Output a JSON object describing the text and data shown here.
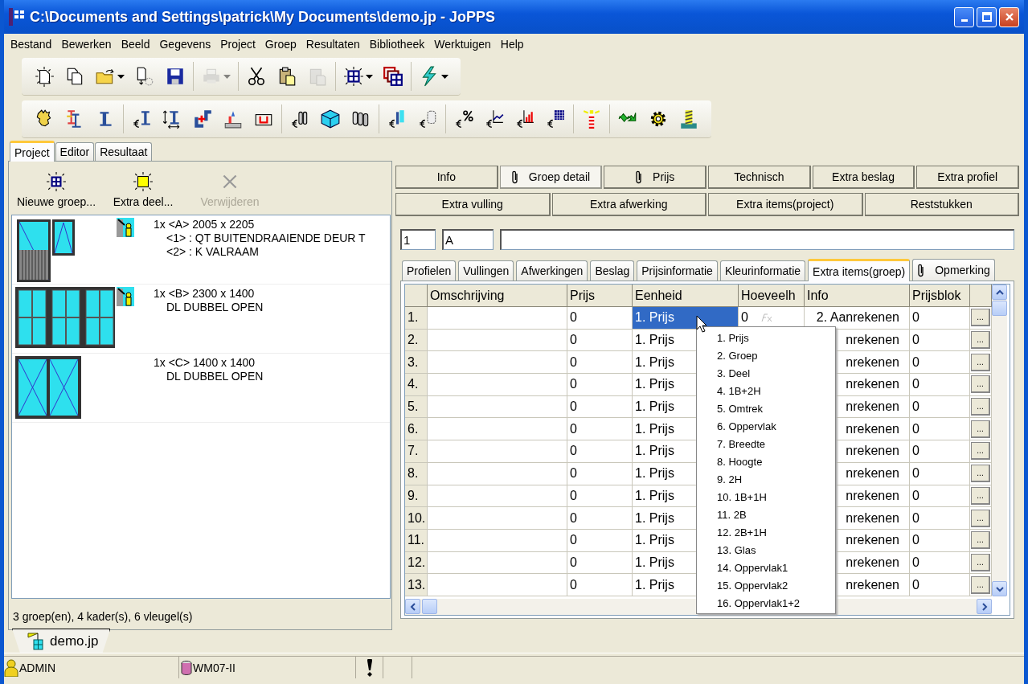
{
  "window": {
    "title": "C:\\Documents and Settings\\patrick\\My Documents\\demo.jp - JoPPS"
  },
  "menu": [
    "Bestand",
    "Bewerken",
    "Beeld",
    "Gegevens",
    "Project",
    "Groep",
    "Resultaten",
    "Bibliotheek",
    "Werktuigen",
    "Help"
  ],
  "toolbars": [
    {
      "groups": [
        [
          {
            "kind": "new-document",
            "disabled": false,
            "dropdown": false
          },
          {
            "kind": "copy",
            "disabled": false,
            "dropdown": false
          },
          {
            "kind": "folder",
            "disabled": false,
            "dropdown": true
          },
          {
            "kind": "import",
            "disabled": false,
            "dropdown": false
          },
          {
            "kind": "save",
            "disabled": false,
            "dropdown": false
          }
        ],
        [
          {
            "kind": "printer",
            "disabled": true,
            "dropdown": true
          }
        ],
        [
          {
            "kind": "scissors",
            "disabled": false,
            "dropdown": false
          },
          {
            "kind": "clipboard",
            "disabled": false,
            "dropdown": false
          },
          {
            "kind": "clipboard-stack",
            "disabled": true,
            "dropdown": false
          }
        ],
        [
          {
            "kind": "grid-sparkle",
            "disabled": false,
            "dropdown": true
          },
          {
            "kind": "grid-stack",
            "disabled": false,
            "dropdown": false
          }
        ],
        [
          {
            "kind": "lightning",
            "disabled": false,
            "dropdown": true
          }
        ]
      ]
    },
    {
      "groups": [
        [
          {
            "kind": "head",
            "disabled": false,
            "dropdown": false
          },
          {
            "kind": "profiles",
            "disabled": false,
            "dropdown": false
          },
          {
            "kind": "profile",
            "disabled": false,
            "dropdown": false
          }
        ],
        [
          {
            "kind": "euro-profile",
            "disabled": false,
            "dropdown": false
          },
          {
            "kind": "profile-dimension",
            "disabled": false,
            "dropdown": false
          },
          {
            "kind": "corner-plus",
            "disabled": false,
            "dropdown": false
          },
          {
            "kind": "welder",
            "disabled": false,
            "dropdown": false
          },
          {
            "kind": "frame",
            "disabled": false,
            "dropdown": false
          }
        ],
        [
          {
            "kind": "euro-columns",
            "disabled": false,
            "dropdown": false
          },
          {
            "kind": "cube",
            "disabled": false,
            "dropdown": false
          },
          {
            "kind": "rolls",
            "disabled": false,
            "dropdown": false
          }
        ],
        [
          {
            "kind": "euro-panel",
            "disabled": false,
            "dropdown": false
          },
          {
            "kind": "euro-roll",
            "disabled": false,
            "dropdown": false
          }
        ],
        [
          {
            "kind": "euro-percent",
            "disabled": false,
            "dropdown": false
          },
          {
            "kind": "euro-line-chart",
            "disabled": false,
            "dropdown": false
          },
          {
            "kind": "euro-bar-chart",
            "disabled": false,
            "dropdown": false
          },
          {
            "kind": "euro-table",
            "disabled": false,
            "dropdown": false
          }
        ],
        [
          {
            "kind": "beacon",
            "disabled": false,
            "dropdown": false
          }
        ],
        [
          {
            "kind": "arrows",
            "disabled": false,
            "dropdown": false
          },
          {
            "kind": "gear",
            "disabled": false,
            "dropdown": false
          },
          {
            "kind": "drill",
            "disabled": false,
            "dropdown": false
          }
        ]
      ]
    }
  ],
  "left_panel": {
    "tabs": [
      {
        "label": "Project",
        "selected": true
      },
      {
        "label": "Editor",
        "selected": false
      },
      {
        "label": "Resultaat",
        "selected": false
      }
    ],
    "actions": [
      {
        "kind": "grid",
        "label": "Nieuwe groep...",
        "disabled": false
      },
      {
        "kind": "square",
        "label": "Extra deel...",
        "disabled": false
      },
      {
        "kind": "cross",
        "label": "Verwijderen",
        "disabled": true
      }
    ],
    "groups": [
      {
        "kind": "door-window",
        "flagged": true,
        "lines": [
          "1x <A> 2005 x 2205",
          "<1> : QT BUITENDRAAIENDE DEUR T",
          "<2> : K VALRAAM"
        ]
      },
      {
        "kind": "triple",
        "flagged": true,
        "lines": [
          "1x <B> 2300 x 1400",
          "DL DUBBEL OPEN"
        ]
      },
      {
        "kind": "double",
        "flagged": false,
        "lines": [
          "1x <C> 1400 x 1400",
          "DL DUBBEL OPEN"
        ]
      }
    ],
    "status": "3 groep(en), 4 kader(s), 6 vleugel(s)"
  },
  "detail": {
    "buttons": [
      [
        {
          "label": "Info",
          "attachment": false,
          "selected": false
        },
        {
          "label": "Groep detail",
          "attachment": true,
          "selected": true
        },
        {
          "label": "Prijs",
          "attachment": true,
          "selected": false
        },
        {
          "label": "Technisch",
          "attachment": false,
          "selected": false
        },
        {
          "label": "Extra beslag",
          "attachment": false,
          "selected": false
        },
        {
          "label": "Extra profiel",
          "attachment": false,
          "selected": false
        }
      ],
      [
        {
          "label": "Extra vulling",
          "attachment": false,
          "selected": false
        },
        {
          "label": "Extra afwerking",
          "attachment": false,
          "selected": false
        },
        {
          "label": "Extra items(project)",
          "attachment": false,
          "selected": false
        },
        {
          "label": "Reststukken",
          "attachment": false,
          "selected": false
        }
      ]
    ],
    "fields": {
      "number": "1",
      "code": "A"
    },
    "tabs": [
      {
        "label": "Profielen",
        "attachment": false,
        "selected": false
      },
      {
        "label": "Vullingen",
        "attachment": false,
        "selected": false
      },
      {
        "label": "Afwerkingen",
        "attachment": false,
        "selected": false
      },
      {
        "label": "Beslag",
        "attachment": false,
        "selected": false
      },
      {
        "label": "Prijsinformatie",
        "attachment": false,
        "selected": false
      },
      {
        "label": "Kleurinformatie",
        "attachment": false,
        "selected": false
      },
      {
        "label": "Extra items(groep)",
        "attachment": false,
        "selected": true
      },
      {
        "label": "Opmerking",
        "attachment": true,
        "selected": false
      }
    ],
    "grid": {
      "columns": [
        "Omschrijving",
        "Prijs",
        "Eenheid",
        "Hoeveelh",
        "Info",
        "Prijsblok"
      ],
      "rows": [
        {
          "number": "1.",
          "prijs": "0",
          "eenheid": "1. Prijs",
          "selected": true,
          "hoeveelheid": "0",
          "info": "2. Aanrekenen",
          "prijsblok": "0",
          "more": "..."
        },
        {
          "number": "2.",
          "prijs": "0",
          "eenheid": "1. Prijs",
          "selected": false,
          "info": "nrekenen",
          "prijsblok": "0",
          "more": "..."
        },
        {
          "number": "3.",
          "prijs": "0",
          "eenheid": "1. Prijs",
          "selected": false,
          "info": "nrekenen",
          "prijsblok": "0",
          "more": "..."
        },
        {
          "number": "4.",
          "prijs": "0",
          "eenheid": "1. Prijs",
          "selected": false,
          "info": "nrekenen",
          "prijsblok": "0",
          "more": "..."
        },
        {
          "number": "5.",
          "prijs": "0",
          "eenheid": "1. Prijs",
          "selected": false,
          "info": "nrekenen",
          "prijsblok": "0",
          "more": "..."
        },
        {
          "number": "6.",
          "prijs": "0",
          "eenheid": "1. Prijs",
          "selected": false,
          "info": "nrekenen",
          "prijsblok": "0",
          "more": "..."
        },
        {
          "number": "7.",
          "prijs": "0",
          "eenheid": "1. Prijs",
          "selected": false,
          "info": "nrekenen",
          "prijsblok": "0",
          "more": "..."
        },
        {
          "number": "8.",
          "prijs": "0",
          "eenheid": "1. Prijs",
          "selected": false,
          "info": "nrekenen",
          "prijsblok": "0",
          "more": "..."
        },
        {
          "number": "9.",
          "prijs": "0",
          "eenheid": "1. Prijs",
          "selected": false,
          "info": "nrekenen",
          "prijsblok": "0",
          "more": "..."
        },
        {
          "number": "10.",
          "prijs": "0",
          "eenheid": "1. Prijs",
          "selected": false,
          "info": "nrekenen",
          "prijsblok": "0",
          "more": "..."
        },
        {
          "number": "11.",
          "prijs": "0",
          "eenheid": "1. Prijs",
          "selected": false,
          "info": "nrekenen",
          "prijsblok": "0",
          "more": "..."
        },
        {
          "number": "12.",
          "prijs": "0",
          "eenheid": "1. Prijs",
          "selected": false,
          "info": "nrekenen",
          "prijsblok": "0",
          "more": "..."
        },
        {
          "number": "13.",
          "prijs": "0",
          "eenheid": "1. Prijs",
          "selected": false,
          "info": "nrekenen",
          "prijsblok": "0",
          "more": "..."
        }
      ],
      "dropdown": [
        "1. Prijs",
        "2. Groep",
        "3. Deel",
        "4. 1B+2H",
        "5. Omtrek",
        "6. Oppervlak",
        "7. Breedte",
        "8. Hoogte",
        "9. 2H",
        "10. 1B+1H",
        "11. 2B",
        "12. 2B+1H",
        "13. Glas",
        "14. Oppervlak1",
        "15. Oppervlak2",
        "16. Oppervlak1+2"
      ]
    }
  },
  "status_bar": {
    "document_tab": "demo.jp",
    "user": "ADMIN",
    "database": "WM07-II"
  }
}
